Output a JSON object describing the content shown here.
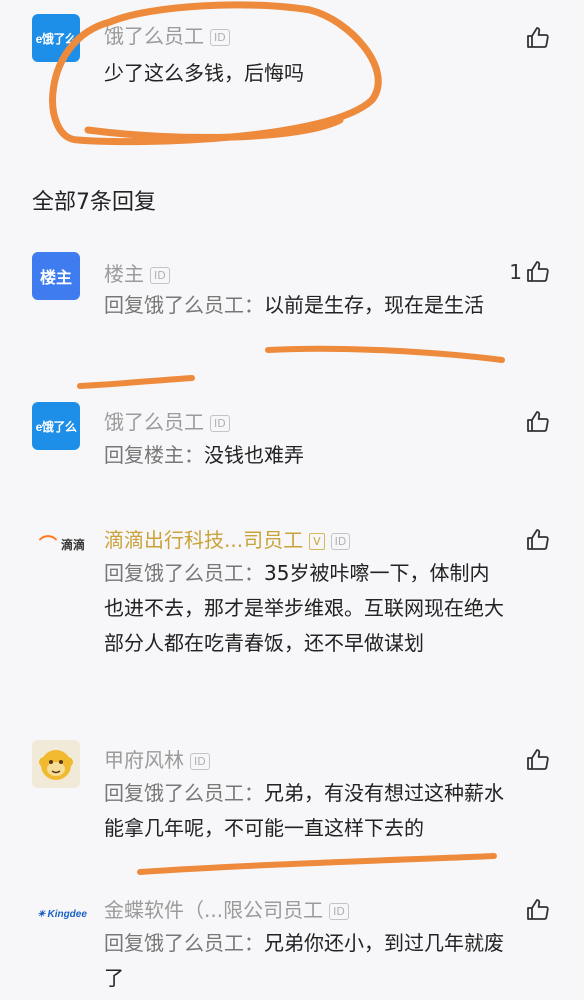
{
  "top_comment": {
    "name": "饿了么员工",
    "avatar_text": "e饿了么",
    "id_badge": "ID",
    "body": "少了这么多钱，后悔吗"
  },
  "replies_header": "全部7条回复",
  "replies": [
    {
      "name": "楼主",
      "avatar_text": "楼主",
      "id_badge": "ID",
      "prefix": "回复饿了么员工：",
      "text": "以前是生存，现在是生活",
      "likes": "1"
    },
    {
      "name": "饿了么员工",
      "avatar_text": "e饿了么",
      "id_badge": "ID",
      "prefix": "回复楼主：",
      "text": "没钱也难弄"
    },
    {
      "name": "滴滴出行科技...司员工",
      "avatar_text": "滴滴",
      "id_badge": "ID",
      "prefix": "回复饿了么员工：",
      "text": "35岁被咔嚓一下，体制内也进不去，那才是举步维艰。互联网现在绝大部分人都在吃青春饭，还不早做谋划"
    },
    {
      "name": "甲府风林",
      "id_badge": "ID",
      "prefix": "回复饿了么员工：",
      "text": "兄弟，有没有想过这种薪水能拿几年呢，不可能一直这样下去的"
    },
    {
      "name": "金蝶软件（...限公司员工",
      "avatar_text": "Kingdee",
      "id_badge": "ID",
      "prefix": "回复饿了么员工：",
      "text": "兄弟你还小，到过几年就废了"
    }
  ],
  "colors": {
    "background": "#f7f7f9",
    "annotation": "#ee8a3c",
    "eleme_blue": "#1e8fe8",
    "author_blue": "#3f7cf0",
    "verified_gold": "#c9a33a"
  },
  "icons": {
    "like": "thumbs-up-icon"
  }
}
